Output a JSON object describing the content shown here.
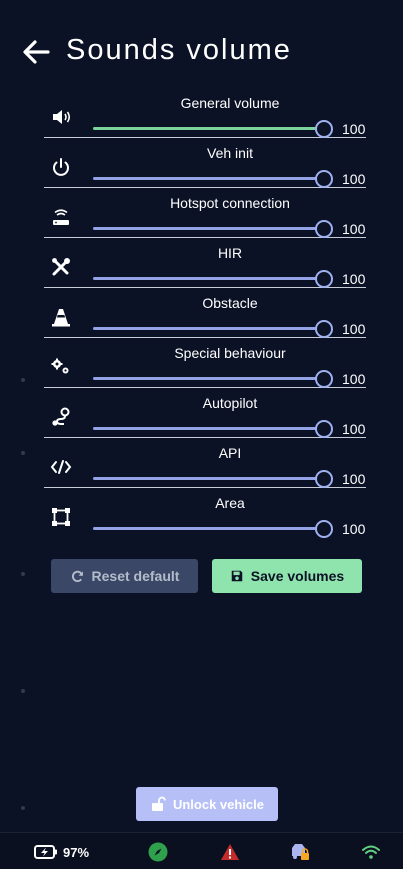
{
  "header": {
    "title": "Sounds volume",
    "back_icon": "arrow-left-icon"
  },
  "volumes": [
    {
      "label": "General volume",
      "value": "100",
      "level": 100,
      "icon": "speaker-icon",
      "track_color": "#79d39b"
    },
    {
      "label": "Veh init",
      "value": "100",
      "level": 100,
      "icon": "power-icon",
      "track_color": "#94a3e6"
    },
    {
      "label": "Hotspot connection",
      "value": "100",
      "level": 100,
      "icon": "router-icon",
      "track_color": "#94a3e6"
    },
    {
      "label": "HIR",
      "value": "100",
      "level": 100,
      "icon": "tools-icon",
      "track_color": "#94a3e6"
    },
    {
      "label": "Obstacle",
      "value": "100",
      "level": 100,
      "icon": "traffic-cone-icon",
      "track_color": "#94a3e6"
    },
    {
      "label": "Special behaviour",
      "value": "100",
      "level": 100,
      "icon": "gears-icon",
      "track_color": "#94a3e6"
    },
    {
      "label": "Autopilot",
      "value": "100",
      "level": 100,
      "icon": "route-icon",
      "track_color": "#94a3e6"
    },
    {
      "label": "API",
      "value": "100",
      "level": 100,
      "icon": "code-icon",
      "track_color": "#94a3e6"
    },
    {
      "label": "Area",
      "value": "100",
      "level": 100,
      "icon": "area-icon",
      "track_color": "#94a3e6"
    }
  ],
  "actions": {
    "reset_label": "Reset default",
    "save_label": "Save volumes",
    "unlock_label": "Unlock vehicle"
  },
  "status": {
    "battery": "97%",
    "icons": [
      "battery-charging-icon",
      "compass-icon",
      "warning-icon",
      "vehicle-locked-icon",
      "wifi-icon"
    ],
    "colors": {
      "compass": "#2fa14d",
      "warning": "#c42b2b",
      "wifi": "#5fd17f",
      "accent": "#8fe3ad"
    }
  }
}
